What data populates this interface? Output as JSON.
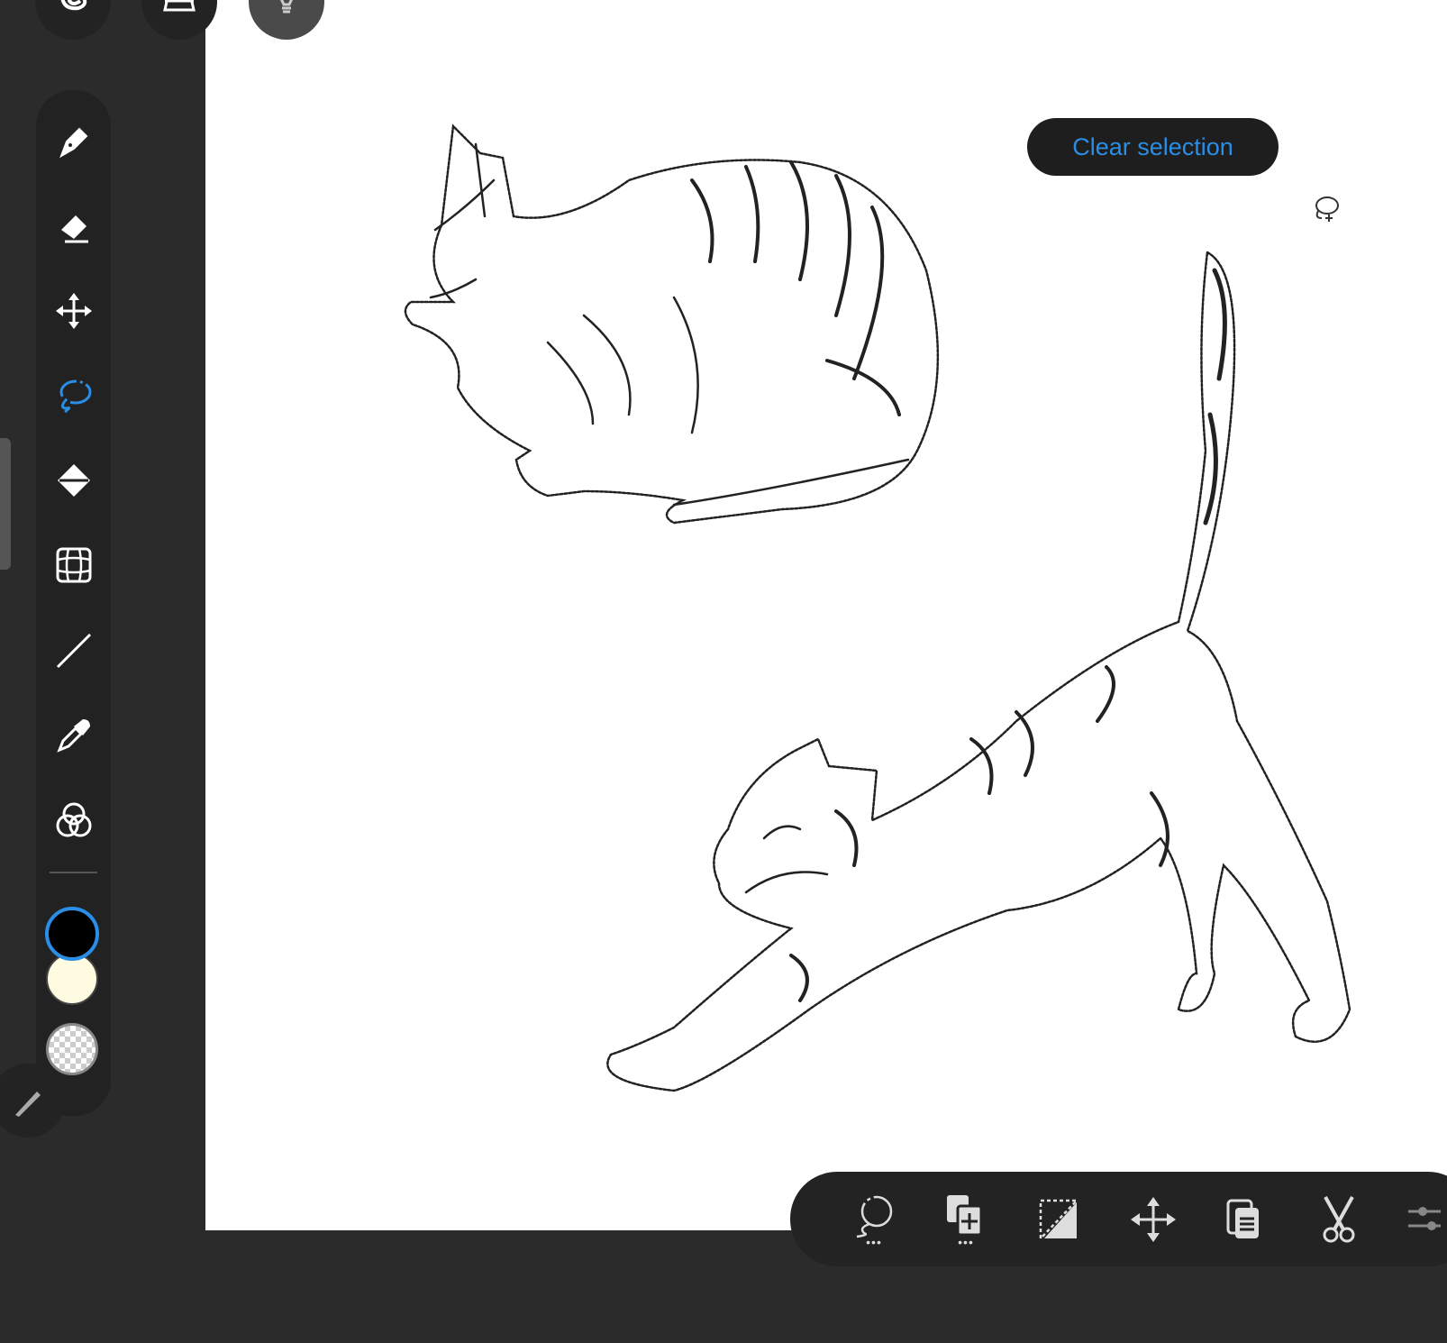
{
  "top_buttons": [
    {
      "icon": "spiral-icon"
    },
    {
      "icon": "gallery-icon"
    },
    {
      "icon": "lightbulb-icon"
    }
  ],
  "tools": [
    {
      "name": "pencil-tool",
      "icon": "pen-icon"
    },
    {
      "name": "eraser-tool",
      "icon": "eraser-icon"
    },
    {
      "name": "transform-tool",
      "icon": "move-icon"
    },
    {
      "name": "lasso-tool",
      "icon": "lasso-icon",
      "active": true
    },
    {
      "name": "fill-tool",
      "icon": "paint-bucket-icon"
    },
    {
      "name": "grid-tool",
      "icon": "perspective-grid-icon"
    },
    {
      "name": "line-tool",
      "icon": "line-icon"
    },
    {
      "name": "eyedropper-tool",
      "icon": "eyedropper-icon"
    },
    {
      "name": "blend-tool",
      "icon": "color-circles-icon"
    }
  ],
  "colors": {
    "primary": "#000000",
    "secondary": "#fffbe0",
    "accent": "#2a8ee6"
  },
  "selection": {
    "clear_label": "Clear selection"
  },
  "selection_actions": [
    {
      "icon": "lasso-options-icon",
      "has_more": true
    },
    {
      "icon": "duplicate-icon",
      "has_more": true
    },
    {
      "icon": "invert-selection-icon"
    },
    {
      "icon": "move-icon"
    },
    {
      "icon": "copy-icon"
    },
    {
      "icon": "cut-icon"
    },
    {
      "icon": "adjust-icon"
    }
  ]
}
